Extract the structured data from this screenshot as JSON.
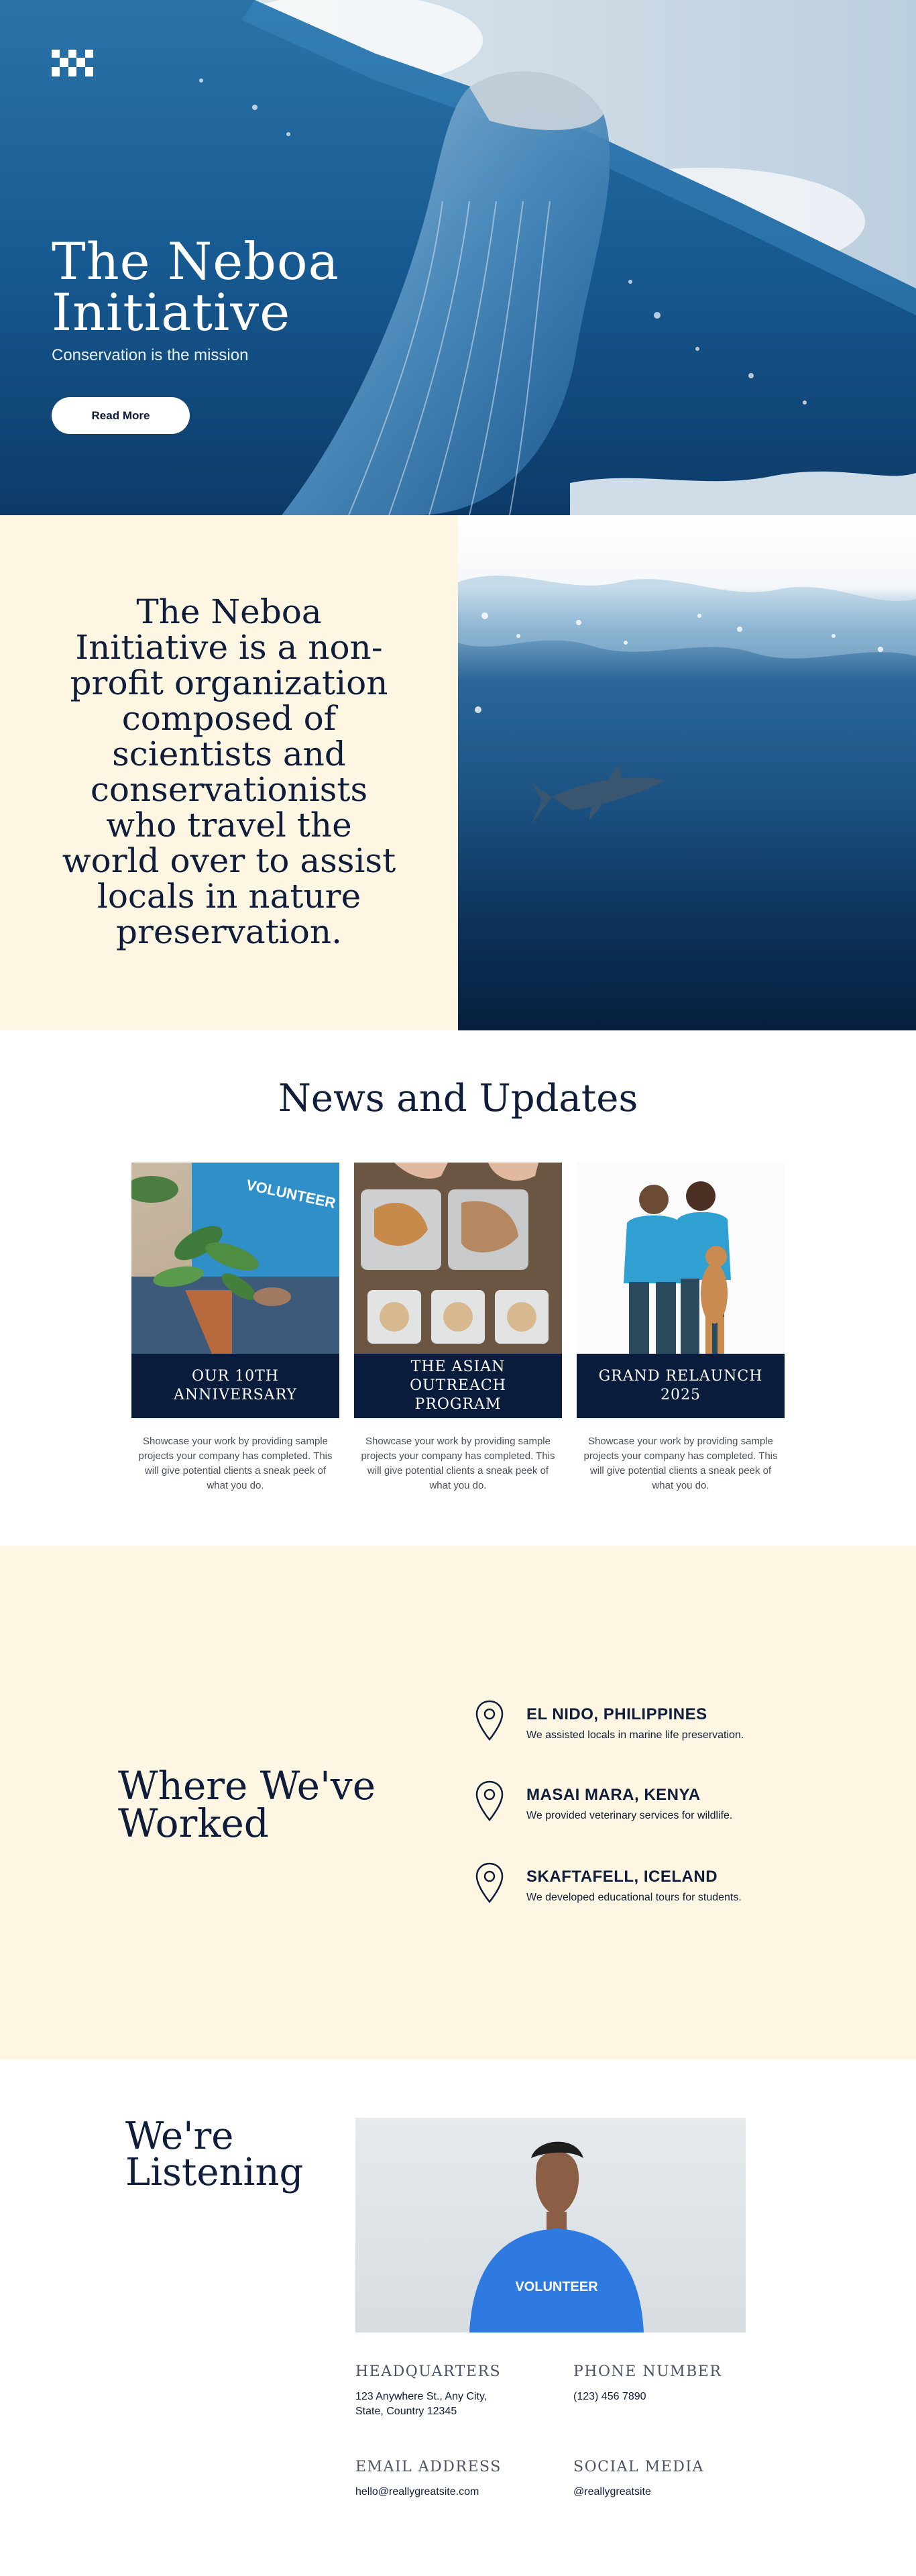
{
  "hero": {
    "title": "The Neboa Initiative",
    "subtitle": "Conservation is the mission",
    "button_label": "Read More"
  },
  "about": {
    "text": "The Neboa Initiative is a non-profit organization composed of scientists and conservationists who travel the world over to assist locals in nature preservation."
  },
  "news": {
    "title": "News and Updates",
    "cards": [
      {
        "title": "OUR 10TH ANNIVERSARY",
        "description": "Showcase your work by providing sample projects your company has completed. This will give potential clients a sneak peek of what you do."
      },
      {
        "title": "THE ASIAN OUTREACH PROGRAM",
        "description": "Showcase your work by providing sample projects your company has completed. This will give potential clients a sneak peek of what you do."
      },
      {
        "title": "GRAND RELAUNCH 2025",
        "description": "Showcase your work by providing sample projects your company has completed. This will give potential clients a sneak peek of what you do."
      }
    ]
  },
  "worked": {
    "title": "Where We've Worked",
    "locations": [
      {
        "name": "EL NIDO, PHILIPPINES",
        "description": "We assisted locals in marine life preservation."
      },
      {
        "name": "MASAI MARA, KENYA",
        "description": "We provided veterinary services for wildlife."
      },
      {
        "name": "SKAFTAFELL, ICELAND",
        "description": "We developed educational tours for students."
      }
    ]
  },
  "listening": {
    "title": "We're Listening",
    "shirt_text": "VOLUNTEER",
    "headquarters_label": "HEADQUARTERS",
    "headquarters_value": "123 Anywhere St., Any City, State, Country 12345",
    "phone_label": "PHONE NUMBER",
    "phone_value": "(123) 456 7890",
    "email_label": "EMAIL ADDRESS",
    "email_value": "hello@reallygreatsite.com",
    "social_label": "SOCIAL MEDIA",
    "social_value": "@reallygreatsite"
  },
  "colors": {
    "navy": "#0f1d3a",
    "cream": "#fdf6e2",
    "banner": "#0a1c3c",
    "ocean": "#1d5f96"
  }
}
